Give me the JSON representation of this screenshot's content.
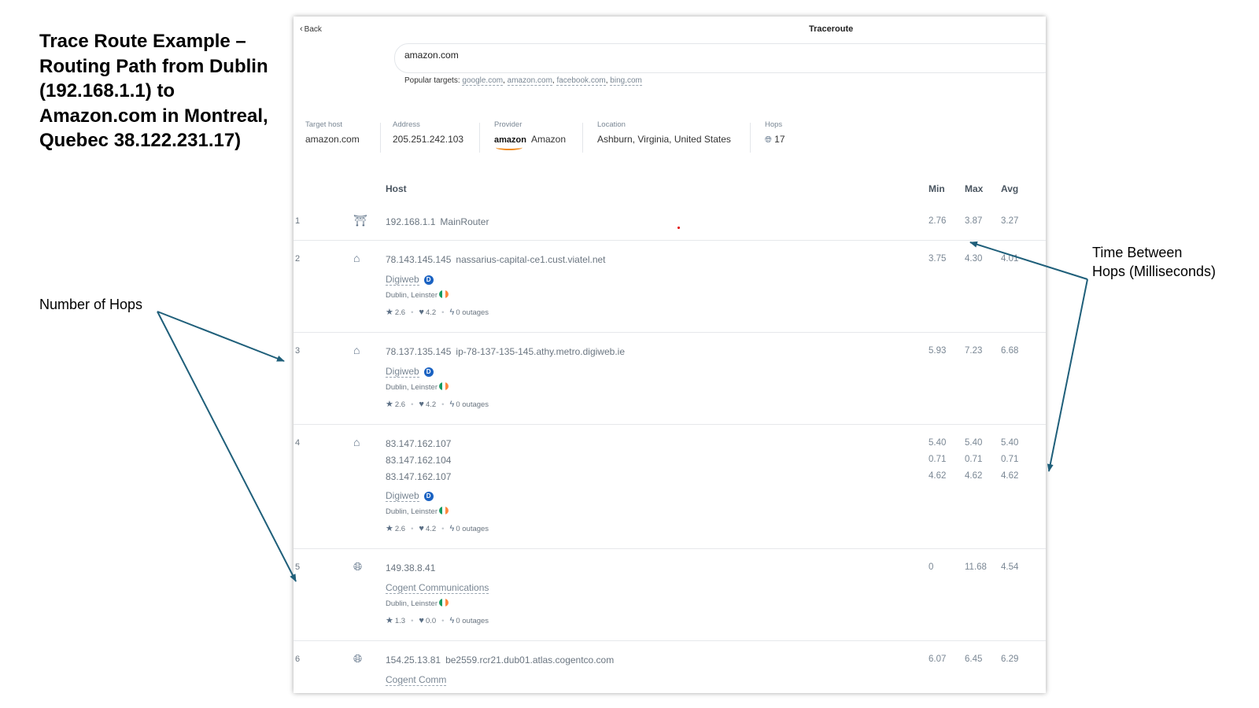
{
  "slide": {
    "title": "Trace Route Example – Routing Path from Dublin (192.168.1.1) to Amazon.com in Montreal, Quebec 38.122.231.17)",
    "hops_label": "Number of Hops",
    "time_label": "Time Between Hops (Milliseconds)",
    "arrow_color": "#1f5f7a"
  },
  "app": {
    "back_label": "Back",
    "title": "Traceroute",
    "search_value": "amazon.com",
    "popular_label": "Popular targets:",
    "popular_targets": [
      "google.com",
      "amazon.com",
      "facebook.com",
      "bing.com"
    ]
  },
  "info": {
    "target_host_label": "Target host",
    "target_host": "amazon.com",
    "address_label": "Address",
    "address": "205.251.242.103",
    "provider_label": "Provider",
    "provider_logo": "amazon",
    "provider": "Amazon",
    "location_label": "Location",
    "location": "Ashburn, Virginia, United States",
    "hops_label": "Hops",
    "hops": "17"
  },
  "table": {
    "headers": {
      "host": "Host",
      "min": "Min",
      "max": "Max",
      "avg": "Avg"
    },
    "rows": [
      {
        "num": "1",
        "icon": "router-icon",
        "ip": "192.168.1.1",
        "rdns": "MainRouter",
        "min": "2.76",
        "max": "3.87",
        "avg": "3.27"
      },
      {
        "num": "2",
        "icon": "home-icon",
        "ip": "78.143.145.145",
        "rdns": "nassarius-capital-ce1.cust.viatel.net",
        "min": "3.75",
        "max": "4.30",
        "avg": "4.01",
        "provider": "Digiweb",
        "location": "Dublin, Leinster",
        "rating": "2.6",
        "likes": "4.2",
        "outages": "0 outages"
      },
      {
        "num": "3",
        "icon": "home-icon",
        "ip": "78.137.135.145",
        "rdns": "ip-78-137-135-145.athy.metro.digiweb.ie",
        "min": "5.93",
        "max": "7.23",
        "avg": "6.68",
        "provider": "Digiweb",
        "location": "Dublin, Leinster",
        "rating": "2.6",
        "likes": "4.2",
        "outages": "0 outages"
      },
      {
        "num": "4",
        "icon": "home-icon",
        "ips": [
          "83.147.162.107",
          "83.147.162.104",
          "83.147.162.107"
        ],
        "mins": [
          "5.40",
          "0.71",
          "4.62"
        ],
        "maxs": [
          "5.40",
          "0.71",
          "4.62"
        ],
        "avgs": [
          "5.40",
          "0.71",
          "4.62"
        ],
        "provider": "Digiweb",
        "location": "Dublin, Leinster",
        "rating": "2.6",
        "likes": "4.2",
        "outages": "0 outages"
      },
      {
        "num": "5",
        "icon": "globe-icon",
        "ip": "149.38.8.41",
        "min": "0",
        "max": "11.68",
        "avg": "4.54",
        "provider": "Cogent Communications",
        "location": "Dublin, Leinster",
        "rating": "1.3",
        "likes": "0.0",
        "outages": "0 outages"
      },
      {
        "num": "6",
        "icon": "globe-icon",
        "ip": "154.25.13.81",
        "rdns": "be2559.rcr21.dub01.atlas.cogentco.com",
        "min": "6.07",
        "max": "6.45",
        "avg": "6.29",
        "provider": "Cogent Comm"
      }
    ]
  },
  "colors": {
    "flag_green": "#169b62",
    "flag_white": "#ffffff",
    "flag_orange": "#ff883e",
    "badge_blue": "#1a62c2"
  }
}
